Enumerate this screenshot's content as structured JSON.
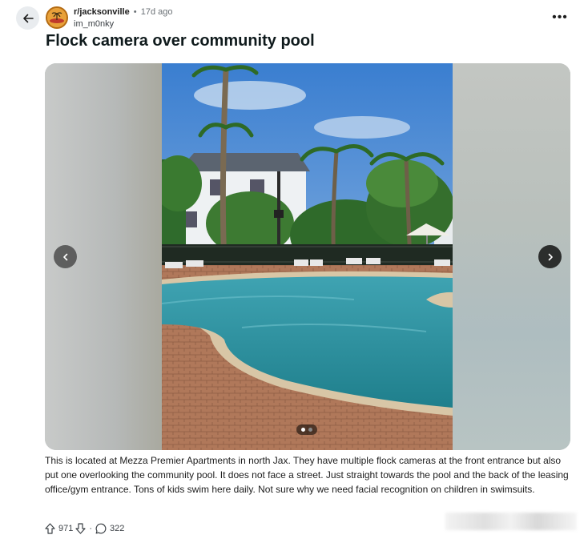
{
  "post": {
    "subreddit": "r/jacksonville",
    "dot": "•",
    "age": "17d ago",
    "username": "im_m0nky",
    "title": "Flock camera over community pool",
    "body": "This is located at Mezza Premier Apartments in north Jax. They have multiple flock cameras at the front entrance but also put one overlooking the community pool. It does not face a street. Just straight towards the pool and the back of the leasing office/gym entrance. Tons of kids swim here daily. Not sure why we need facial recognition on children in swimsuits.",
    "score": "971",
    "comment_count": "322",
    "separator": "·",
    "more_glyph": "•••"
  },
  "gallery": {
    "current_index": 1,
    "total": 2
  },
  "icons": {
    "back": "arrow-left-icon",
    "more": "overflow-menu-icon",
    "prev": "chevron-left-icon",
    "next": "chevron-right-icon",
    "upvote": "upvote-arrow-icon",
    "downvote": "downvote-arrow-icon",
    "comment": "comment-bubble-icon"
  },
  "colors": {
    "accent_text": "#1c1c1c",
    "muted_text": "#6a7075",
    "avatar_bg": "#e8a13a"
  }
}
